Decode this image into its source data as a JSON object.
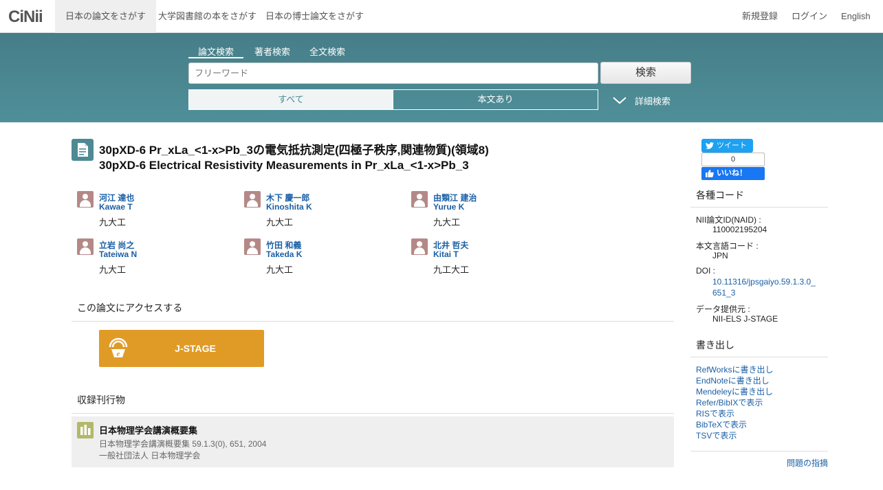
{
  "nav": {
    "logo": "CiNii",
    "tabs": [
      "日本の論文をさがす",
      "大学図書館の本をさがす",
      "日本の博士論文をさがす"
    ],
    "register": "新規登録",
    "login": "ログイン",
    "language": "English"
  },
  "search": {
    "tabs": [
      "論文検索",
      "著者検索",
      "全文検索"
    ],
    "placeholder": "フリーワード",
    "button": "検索",
    "filter_all": "すべて",
    "filter_fulltext": "本文あり",
    "advanced": "詳細検索"
  },
  "article": {
    "title_ja": "30pXD-6 Pr_xLa_<1-x>Pb_3の電気抵抗測定(四極子秩序,関連物質)(領域8)",
    "title_en": "30pXD-6 Electrical Resistivity Measurements in Pr_xLa_<1-x>Pb_3",
    "authors": [
      {
        "name": "河江 達也",
        "name_en": "Kawae T",
        "affiliation": "九大工"
      },
      {
        "name": "木下 慶一郎",
        "name_en": "Kinoshita K",
        "affiliation": "九大工"
      },
      {
        "name": "由類江 建治",
        "name_en": "Yurue K",
        "affiliation": "九大工"
      },
      {
        "name": "立岩 尚之",
        "name_en": "Tateiwa N",
        "affiliation": "九大工"
      },
      {
        "name": "竹田 和義",
        "name_en": "Takeda K",
        "affiliation": "九大工"
      },
      {
        "name": "北井 哲夫",
        "name_en": "Kitai T",
        "affiliation": "九工大工"
      }
    ]
  },
  "access": {
    "heading": "この論文にアクセスする",
    "jstage_label": "J-STAGE"
  },
  "journal": {
    "heading": "収録刊行物",
    "title": "日本物理学会講演概要集",
    "volume": "日本物理学会講演概要集 59.1.3(0), 651, 2004",
    "publisher": "一般社団法人 日本物理学会"
  },
  "sidebar": {
    "tweet": "ツイート",
    "like_count": "0",
    "like": "いいね！",
    "codes_heading": "各種コード",
    "naid_label": "NII論文ID(NAID) :",
    "naid": "110002195204",
    "lang_label": "本文言語コード :",
    "lang": "JPN",
    "doi_label": "DOI :",
    "doi": "10.11316/jpsgaiyo.59.1.3.0_651_3",
    "provider_label": "データ提供元 :",
    "provider": "NII-ELS  J-STAGE",
    "export_heading": "書き出し",
    "exports": [
      "RefWorksに書き出し",
      "EndNoteに書き出し",
      "Mendeleyに書き出し",
      "Refer/BibIXで表示",
      "RISで表示",
      "BibTeXで表示",
      "TSVで表示"
    ],
    "report": "問題の指摘"
  },
  "colors": {
    "band": "#4a858f",
    "link": "#1a5fa5",
    "jstage": "#e09b26",
    "journal_icon": "#b3b86a",
    "avatar": "#b58888"
  }
}
